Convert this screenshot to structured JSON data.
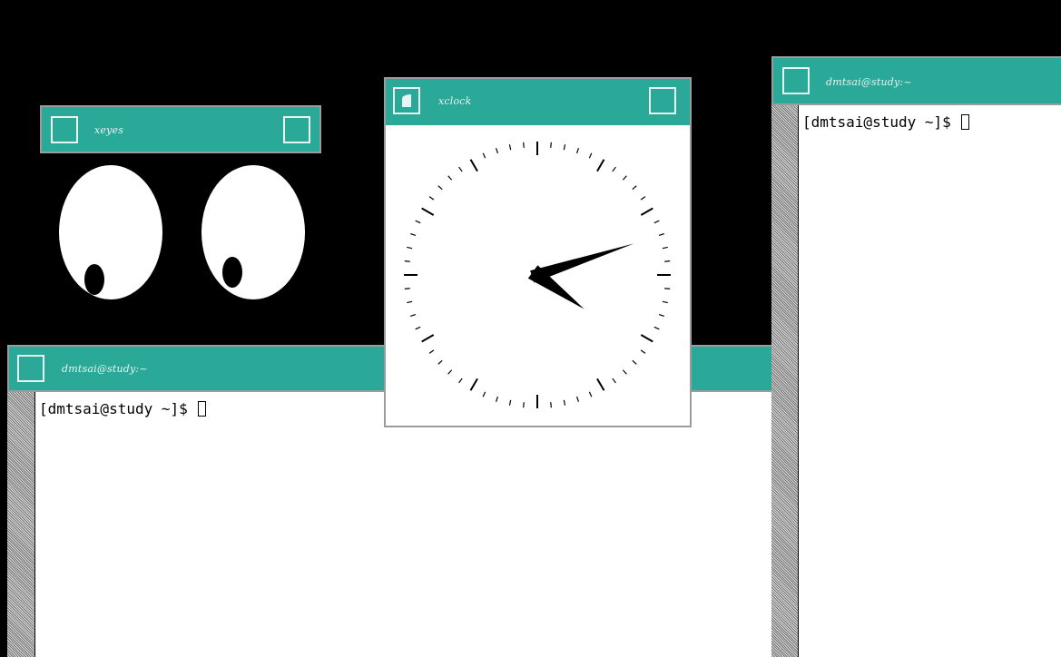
{
  "xeyes": {
    "title": "xeyes"
  },
  "xclock": {
    "title": "xclock",
    "time": {
      "hour": 4,
      "minute": 12
    }
  },
  "terminal_bottom": {
    "title": "dmtsai@study:~",
    "prompt": "[dmtsai@study ~]$ "
  },
  "terminal_right": {
    "title": "dmtsai@study:~",
    "prompt": "[dmtsai@study ~]$ "
  },
  "colors": {
    "desktop": "#000000",
    "titlebar": "#2aa898",
    "title_text": "#e8f4f2",
    "window_body": "#ffffff"
  },
  "icons": {
    "titlebar_left": "window-menu-icon",
    "titlebar_right": "maximize-icon",
    "xclock_left": "iconify-icon"
  }
}
